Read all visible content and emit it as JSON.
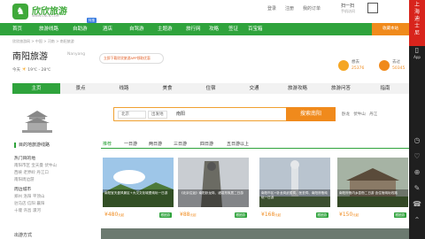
{
  "site": {
    "logo": "欣欣旅游",
    "logo_sub": "WWW.CNCN.COM"
  },
  "toplinks": [
    "登录",
    "注册",
    "我的订单"
  ],
  "scan": {
    "label": "扫一扫",
    "sub": "手机访问"
  },
  "nav": {
    "items": [
      "首页",
      "旅游线路",
      "自助游",
      "酒店",
      "自驾游",
      "主题游",
      "旅行网",
      "攻略",
      "签证",
      "百宝箱"
    ],
    "badge": "特惠",
    "fav": "收藏本站"
  },
  "sidebar": {
    "ad": [
      "上",
      "海",
      "迪",
      "士",
      "尼"
    ],
    "app": "App"
  },
  "breadcrumb": [
    "欣欣旅游网",
    "中国",
    "河南",
    "南阳旅游"
  ],
  "city": {
    "name": "南阳旅游",
    "pinyin": "Nanyang",
    "weather": "19℃ - 28℃",
    "weather_prefix": "今天",
    "promo": "立即下载欣欣旅游APP领取优惠"
  },
  "stats": [
    {
      "label": "想去",
      "value": "25376"
    },
    {
      "label": "去过",
      "value": "50345"
    }
  ],
  "tabs": [
    "主页",
    "景点",
    "线路",
    "美食",
    "住宿",
    "交通",
    "旅游攻略",
    "旅游问答",
    "指南"
  ],
  "search": {
    "from": "北京",
    "type": "出发地",
    "keyword": "南阳",
    "button": "搜索南阳",
    "hotwords": [
      "卧龙",
      "伏牛山",
      "丹江"
    ]
  },
  "section": {
    "title": "目的地旅游线路"
  },
  "dayfilter": [
    "推荐",
    "一日游",
    "两日游",
    "三日游",
    "四日游",
    "五日游以上"
  ],
  "leftlist": {
    "groups": [
      {
        "heading": "热门目的地",
        "items": [
          "南阳市区 宝天曼 伏牛山",
          "西峡 老界岭 丹江口",
          "南阳周边游"
        ]
      },
      {
        "heading": "周边城市",
        "items": [
          "郑州 洛阳 平顶山",
          "驻马店 信阳 襄阳",
          "十堰 许昌 漯河"
        ]
      }
    ]
  },
  "cards": [
    {
      "caption": "南阳宝天曼风景区+大汉文化城堡纯玩一日游",
      "price": "480",
      "price_suffix": "元起",
      "tag": "跟团游"
    },
    {
      "caption": "《北京往返》南阳卧龙岗、诸葛亮故居二日游",
      "price": "88",
      "price_suffix": "元起",
      "tag": "跟团游"
    },
    {
      "caption": "南阳市区+卧龙岗武侯祠、医圣祠、南阳府衙纯玩一日游",
      "price": "168",
      "price_suffix": "元起",
      "tag": "跟团游"
    },
    {
      "caption": "南阳府衙内乡县衙二日游 含住宿纯玩线路",
      "price": "150",
      "price_suffix": "元起",
      "tag": "跟团游"
    }
  ],
  "bottom": {
    "label": "出游方式"
  },
  "colors": {
    "brand": "#2fa33c",
    "accent": "#f08a1c",
    "nav": "#2fa33c"
  }
}
